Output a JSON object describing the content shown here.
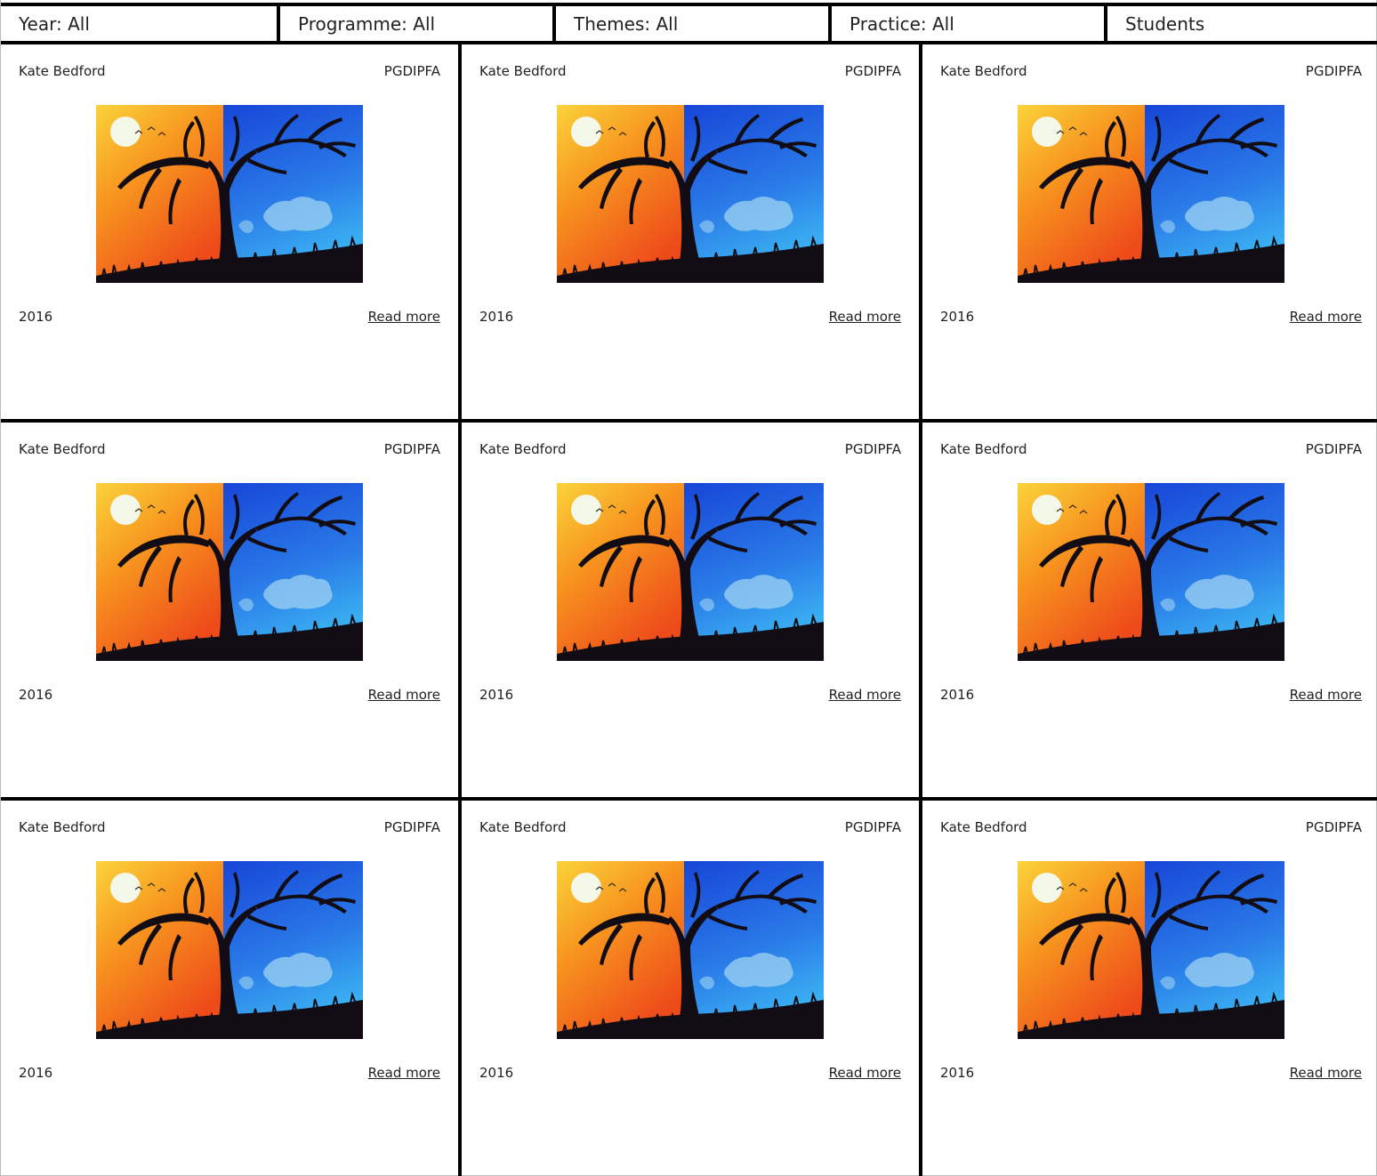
{
  "filters": [
    {
      "label": "Year: All"
    },
    {
      "label": "Programme: All"
    },
    {
      "label": "Themes: All"
    },
    {
      "label": "Practice: All"
    },
    {
      "label": "Students"
    }
  ],
  "cards": [
    {
      "student": "Kate Bedford",
      "programme": "PGDIPFA",
      "year": "2016",
      "link": "Read more"
    },
    {
      "student": "Kate Bedford",
      "programme": "PGDIPFA",
      "year": "2016",
      "link": "Read more"
    },
    {
      "student": "Kate Bedford",
      "programme": "PGDIPFA",
      "year": "2016",
      "link": "Read more"
    },
    {
      "student": "Kate Bedford",
      "programme": "PGDIPFA",
      "year": "2016",
      "link": "Read more"
    },
    {
      "student": "Kate Bedford",
      "programme": "PGDIPFA",
      "year": "2016",
      "link": "Read more"
    },
    {
      "student": "Kate Bedford",
      "programme": "PGDIPFA",
      "year": "2016",
      "link": "Read more"
    },
    {
      "student": "Kate Bedford",
      "programme": "PGDIPFA",
      "year": "2016",
      "link": "Read more"
    },
    {
      "student": "Kate Bedford",
      "programme": "PGDIPFA",
      "year": "2016",
      "link": "Read more"
    },
    {
      "student": "Kate Bedford",
      "programme": "PGDIPFA",
      "year": "2016",
      "link": "Read more"
    }
  ],
  "colors": {
    "divider": "#000000",
    "sun_sky": "#f7a81b",
    "sunset": "#f0521c",
    "night_sky": "#1d5fe0",
    "moon": "#cfe3f5"
  }
}
